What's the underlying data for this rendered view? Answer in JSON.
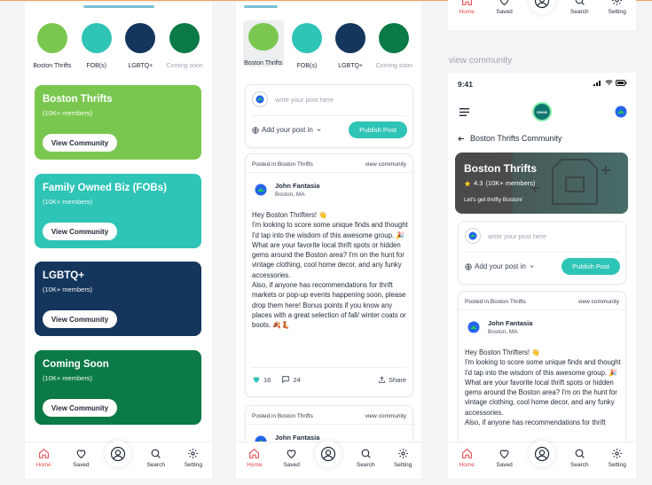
{
  "colors": {
    "accent": "#2ec4b6",
    "nav_active": "#e5484d",
    "card_boston": "#7ac74f",
    "card_fob": "#2ec4b6",
    "card_lgbtq": "#14365d",
    "card_soon": "#0b7a46"
  },
  "categories": [
    {
      "label": "Boston Thrifts",
      "color": "#7ac74f"
    },
    {
      "label": "FOB(s)",
      "color": "#2ec4b6"
    },
    {
      "label": "LGBTQ+",
      "color": "#14365d"
    },
    {
      "label": "Coming soon",
      "color": "#0b7a46"
    }
  ],
  "communities": [
    {
      "title": "Boston Thrifts",
      "members": "(10K+ members)",
      "button": "View Community"
    },
    {
      "title": "Family Owned Biz (FOBs)",
      "members": "(10K+ members)",
      "button": "View Community"
    },
    {
      "title": "LGBTQ+",
      "members": "(10K+ members)",
      "button": "View Community"
    },
    {
      "title": "Coming Soon",
      "members": "(10K+ members)",
      "button": "View Community"
    }
  ],
  "nav": {
    "home": "Home",
    "saved": "Saved",
    "search": "Search",
    "setting": "Setting"
  },
  "composer": {
    "placeholder": "write your post here",
    "post_in": "Add your post in",
    "publish": "Publish Post"
  },
  "post": {
    "posted_in": "Posted in Boston Thrifts",
    "view_community": "view community",
    "author": "John Fantasia",
    "location": "Boston, MA",
    "body_p2": "Hey Boston Thrifters! 👋\nI'm looking to score some unique finds and thought I'd tap into the wisdom of this awesome group. 🎉 What are your favorite local thrift spots or hidden gems around the Boston area? I'm on the hunt for vintage clothing, cool home decor, and any funky accessories.\nAlso, if anyone has recommendations for thrift markets or pop-up events happening soon, please drop them here! Bonus points if you know any places with a great selection of fall/ winter coats or boots. 🍂👢",
    "body_p3": "Hey Boston Thrifters! 👋\nI'm looking to score some unique finds and thought I'd tap into the wisdom of this awesome group. 🎉 What are your favorite local thrift spots or hidden gems around the Boston area? I'm on the hunt for vintage clothing, cool home decor, and any funky accessories.\nAlso, if anyone has recommendations for thrift",
    "likes": "16",
    "comments": "24",
    "share": "Share"
  },
  "section_label": "view community",
  "phone3": {
    "time": "9:41",
    "logo_text": "SWAB",
    "back_title": "Boston Thrifts Community",
    "hero_title": "Boston Thrifts",
    "rating": "4.3",
    "rating_members": "(10K+ members)",
    "tagline": "Let's get thrifty Boston!"
  }
}
